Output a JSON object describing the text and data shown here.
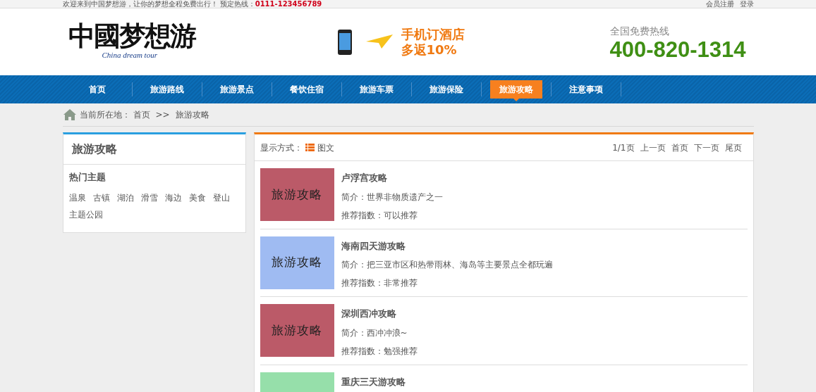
{
  "top_bar": {
    "welcome": "欢迎来到中国梦想游，让你的梦想全程免费出行！ 预定热线：",
    "hotline": "0111-123456789",
    "links": [
      "会员注册",
      "登录"
    ]
  },
  "header": {
    "logo": {
      "title": "中國梦想游",
      "subtitle": "China dream tour"
    },
    "promo": [
      "手机订酒店",
      "多返10%"
    ],
    "hotline_label": "全国免费热线",
    "hotline": "400-820-1314"
  },
  "nav": [
    {
      "label": "首页",
      "selected": false
    },
    {
      "label": "旅游路线",
      "selected": false
    },
    {
      "label": "旅游景点",
      "selected": false
    },
    {
      "label": "餐饮住宿",
      "selected": false
    },
    {
      "label": "旅游车票",
      "selected": false
    },
    {
      "label": "旅游保险",
      "selected": false
    },
    {
      "label": "旅游攻略",
      "selected": true
    },
    {
      "label": "注意事项",
      "selected": false
    }
  ],
  "breadcrumb": {
    "label": "当前所在地：",
    "items": [
      "首页",
      ">>",
      "旅游攻略"
    ]
  },
  "sidebar": {
    "title": "旅游攻略",
    "section": "热门主题",
    "tags": [
      "温泉",
      "古镇",
      "湖泊",
      "滑雪",
      "海边",
      "美食",
      "登山",
      "主题公园"
    ]
  },
  "list": {
    "display_label": "显示方式：",
    "display_mode": "图文",
    "pager": [
      "1/1页",
      "上一页",
      "首页",
      "下一页",
      "尾页"
    ],
    "items": [
      {
        "thumb_text": "旅游攻略",
        "color": "#bb5a68",
        "title": "卢浮宫攻略",
        "intro": "简介：世界非物质遗产之一",
        "rating": "推荐指数：可以推荐"
      },
      {
        "thumb_text": "旅游攻略",
        "color": "#9fbbf2",
        "title": "海南四天游攻略",
        "intro": "简介：把三亚市区和热带雨林、海岛等主要景点全都玩遍",
        "rating": "推荐指数：非常推荐"
      },
      {
        "thumb_text": "旅游攻略",
        "color": "#bb5a68",
        "title": "深圳西冲攻略",
        "intro": "简介：西冲冲浪~",
        "rating": "推荐指数：勉强推荐"
      },
      {
        "color": "#96dfaa",
        "title": "重庆三天游攻略"
      }
    ]
  }
}
